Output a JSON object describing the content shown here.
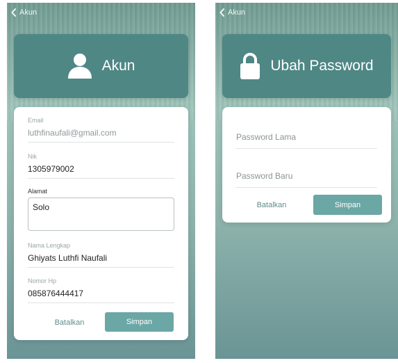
{
  "left": {
    "back_label": "Akun",
    "header_title": "Akun",
    "email": {
      "label": "Email",
      "value": "luthfinaufali@gmail.com"
    },
    "nik": {
      "label": "Nik",
      "value": "1305979002"
    },
    "alamat": {
      "label": "Alamat",
      "value": "Solo"
    },
    "nama": {
      "label": "Nama Lengkap",
      "value": "Ghiyats Luthfi Naufali"
    },
    "hp": {
      "label": "Nomor Hp",
      "value": "085876444417"
    },
    "cancel_label": "Batalkan",
    "save_label": "Simpan"
  },
  "right": {
    "back_label": "Akun",
    "header_title": "Ubah Password",
    "old_password_placeholder": "Password Lama",
    "new_password_placeholder": "Password Baru",
    "cancel_label": "Batalkan",
    "save_label": "Simpan"
  },
  "colors": {
    "header": "#4f8785",
    "save_button": "#6ba7a5",
    "accent_text": "#5f8d8b"
  },
  "icons": {
    "left_header": "user-icon",
    "right_header": "lock-icon",
    "back": "chevron-left-icon"
  }
}
